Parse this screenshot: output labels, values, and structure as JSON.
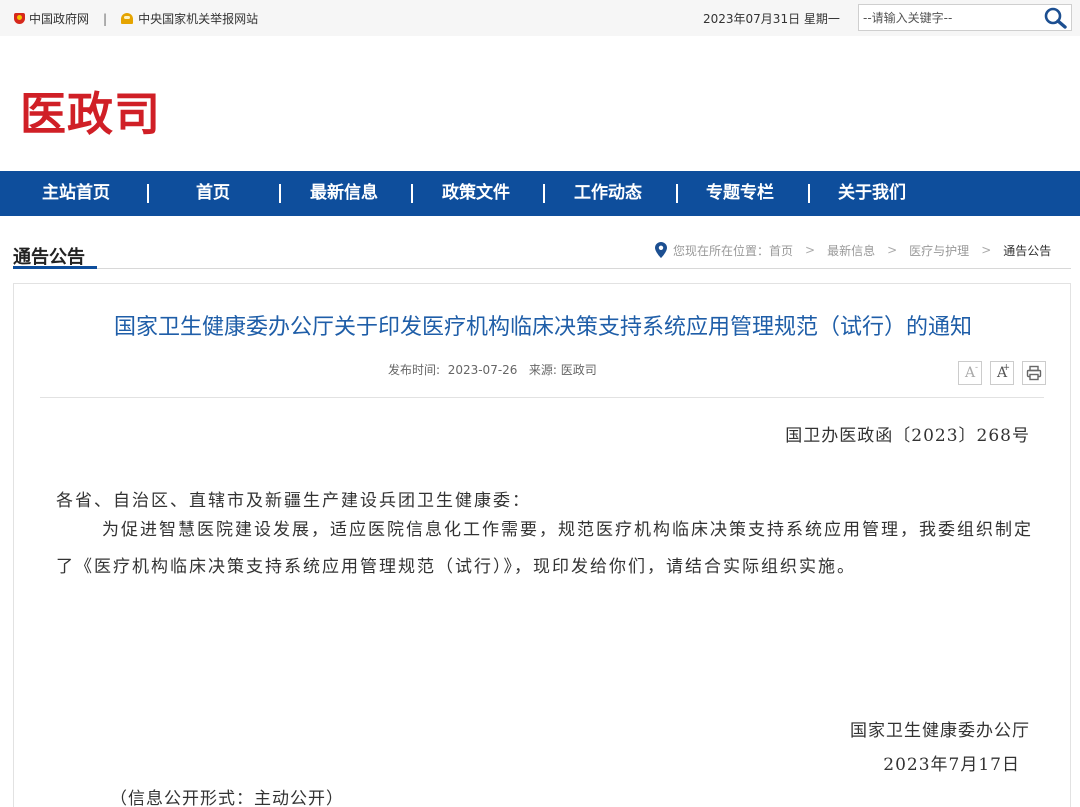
{
  "topbar": {
    "gov_link": "中国政府网",
    "separator": "|",
    "report_link": "中央国家机关举报网站",
    "date": "2023年07月31日 星期一",
    "search_placeholder": "--请输入关键字--"
  },
  "header": {
    "logo_text": "医政司",
    "logo_color": "#d01f26"
  },
  "nav": {
    "color": "#0e4e9c",
    "items": [
      "主站首页",
      "首页",
      "最新信息",
      "政策文件",
      "工作动态",
      "专题专栏",
      "关于我们"
    ]
  },
  "section": {
    "title": "通告公告"
  },
  "breadcrumb": {
    "prefix": "您现在所在位置：",
    "items": [
      "首页",
      "最新信息",
      "医疗与护理"
    ],
    "current": "通告公告",
    "separator": ">"
  },
  "article": {
    "title": "国家卫生健康委办公厅关于印发医疗机构临床决策支持系统应用管理规范（试行）的通知",
    "title_color": "#1f5ea8",
    "publish_label": "发布时间:",
    "publish_date": "2023-07-26",
    "source_label": "来源:",
    "source": "医政司",
    "tools": {
      "font_decrease": "A",
      "font_increase": "A",
      "font_decrease_mark": "-",
      "font_increase_mark": "+",
      "print_icon": "print-icon"
    },
    "doc_number": "国卫办医政函〔2023〕268号",
    "greeting": "各省、自治区、直辖市及新疆生产建设兵团卫生健康委：",
    "paragraph": "为促进智慧医院建设发展，适应医院信息化工作需要，规范医疗机构临床决策支持系统应用管理，我委组织制定了《医疗机构临床决策支持系统应用管理规范（试行）》，现印发给你们，请结合实际组织实施。",
    "signer": "国家卫生健康委办公厅",
    "sign_date": "2023年7月17日",
    "disclosure": "（信息公开形式：主动公开）"
  }
}
